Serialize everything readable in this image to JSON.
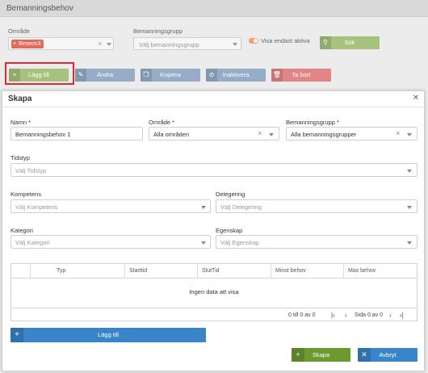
{
  "background": {
    "title": "Bemanningsbehov",
    "omrade_label": "Område",
    "omrade_chip": "Beseos3",
    "grupp_label": "Bemanningsgrupp",
    "grupp_placeholder": "Välj bemanningsgrupp",
    "visa_aktiva_label": "Visa endast aktiva",
    "visa_aktiva_on": true,
    "sok_label": "Sök",
    "toolbar": {
      "lagg_till": "Lägg till",
      "andra": "Ändra",
      "kopiera": "Kopiera",
      "inaktivera": "Inaktivera",
      "ta_bort": "Ta bort"
    }
  },
  "modal": {
    "title": "Skapa",
    "namn_label": "Namn *",
    "namn_value": "Bemanningsbehov 1",
    "omrade_label": "Område *",
    "omrade_value": "Alla områden",
    "grupp_label": "Bemanningsgrupp *",
    "grupp_value": "Alla bemanningsgrupper",
    "tidstyp_label": "Tidstyp",
    "tidstyp_placeholder": "Välj Tidstyp",
    "kompetens_label": "Kompetens",
    "kompetens_placeholder": "Välj Kompetens",
    "delegering_label": "Delegering",
    "delegering_placeholder": "Välj Delegering",
    "kategori_label": "Kategori",
    "kategori_placeholder": "Välj Kategori",
    "egenskap_label": "Egenskap",
    "egenskap_placeholder": "Välj Egenskap",
    "grid": {
      "columns": [
        "Typ",
        "Starttid",
        "SlutTid",
        "Minst behov",
        "Max behov"
      ],
      "empty_text": "Ingen data att visa",
      "paging_info": "0 till 0 av 0",
      "page_text": "Sida 0 av 0"
    },
    "add_row_label": "Lägg till",
    "skapa_label": "Skapa",
    "avbryt_label": "Avbryt"
  },
  "colors": {
    "green": "#6c9a2e",
    "blue": "#3a85c9",
    "highlight": "#d9293b",
    "chip": "#e06a5b"
  }
}
